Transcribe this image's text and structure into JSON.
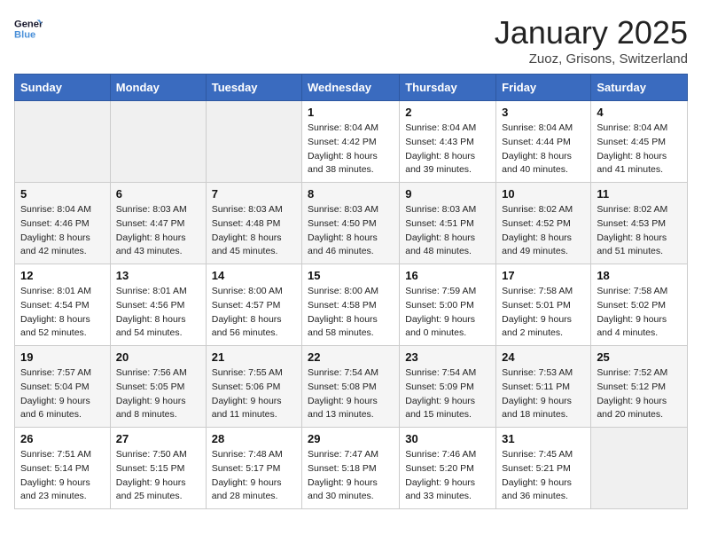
{
  "header": {
    "logo_line1": "General",
    "logo_line2": "Blue",
    "month": "January 2025",
    "location": "Zuoz, Grisons, Switzerland"
  },
  "weekdays": [
    "Sunday",
    "Monday",
    "Tuesday",
    "Wednesday",
    "Thursday",
    "Friday",
    "Saturday"
  ],
  "weeks": [
    [
      {
        "day": "",
        "info": ""
      },
      {
        "day": "",
        "info": ""
      },
      {
        "day": "",
        "info": ""
      },
      {
        "day": "1",
        "info": "Sunrise: 8:04 AM\nSunset: 4:42 PM\nDaylight: 8 hours\nand 38 minutes."
      },
      {
        "day": "2",
        "info": "Sunrise: 8:04 AM\nSunset: 4:43 PM\nDaylight: 8 hours\nand 39 minutes."
      },
      {
        "day": "3",
        "info": "Sunrise: 8:04 AM\nSunset: 4:44 PM\nDaylight: 8 hours\nand 40 minutes."
      },
      {
        "day": "4",
        "info": "Sunrise: 8:04 AM\nSunset: 4:45 PM\nDaylight: 8 hours\nand 41 minutes."
      }
    ],
    [
      {
        "day": "5",
        "info": "Sunrise: 8:04 AM\nSunset: 4:46 PM\nDaylight: 8 hours\nand 42 minutes."
      },
      {
        "day": "6",
        "info": "Sunrise: 8:03 AM\nSunset: 4:47 PM\nDaylight: 8 hours\nand 43 minutes."
      },
      {
        "day": "7",
        "info": "Sunrise: 8:03 AM\nSunset: 4:48 PM\nDaylight: 8 hours\nand 45 minutes."
      },
      {
        "day": "8",
        "info": "Sunrise: 8:03 AM\nSunset: 4:50 PM\nDaylight: 8 hours\nand 46 minutes."
      },
      {
        "day": "9",
        "info": "Sunrise: 8:03 AM\nSunset: 4:51 PM\nDaylight: 8 hours\nand 48 minutes."
      },
      {
        "day": "10",
        "info": "Sunrise: 8:02 AM\nSunset: 4:52 PM\nDaylight: 8 hours\nand 49 minutes."
      },
      {
        "day": "11",
        "info": "Sunrise: 8:02 AM\nSunset: 4:53 PM\nDaylight: 8 hours\nand 51 minutes."
      }
    ],
    [
      {
        "day": "12",
        "info": "Sunrise: 8:01 AM\nSunset: 4:54 PM\nDaylight: 8 hours\nand 52 minutes."
      },
      {
        "day": "13",
        "info": "Sunrise: 8:01 AM\nSunset: 4:56 PM\nDaylight: 8 hours\nand 54 minutes."
      },
      {
        "day": "14",
        "info": "Sunrise: 8:00 AM\nSunset: 4:57 PM\nDaylight: 8 hours\nand 56 minutes."
      },
      {
        "day": "15",
        "info": "Sunrise: 8:00 AM\nSunset: 4:58 PM\nDaylight: 8 hours\nand 58 minutes."
      },
      {
        "day": "16",
        "info": "Sunrise: 7:59 AM\nSunset: 5:00 PM\nDaylight: 9 hours\nand 0 minutes."
      },
      {
        "day": "17",
        "info": "Sunrise: 7:58 AM\nSunset: 5:01 PM\nDaylight: 9 hours\nand 2 minutes."
      },
      {
        "day": "18",
        "info": "Sunrise: 7:58 AM\nSunset: 5:02 PM\nDaylight: 9 hours\nand 4 minutes."
      }
    ],
    [
      {
        "day": "19",
        "info": "Sunrise: 7:57 AM\nSunset: 5:04 PM\nDaylight: 9 hours\nand 6 minutes."
      },
      {
        "day": "20",
        "info": "Sunrise: 7:56 AM\nSunset: 5:05 PM\nDaylight: 9 hours\nand 8 minutes."
      },
      {
        "day": "21",
        "info": "Sunrise: 7:55 AM\nSunset: 5:06 PM\nDaylight: 9 hours\nand 11 minutes."
      },
      {
        "day": "22",
        "info": "Sunrise: 7:54 AM\nSunset: 5:08 PM\nDaylight: 9 hours\nand 13 minutes."
      },
      {
        "day": "23",
        "info": "Sunrise: 7:54 AM\nSunset: 5:09 PM\nDaylight: 9 hours\nand 15 minutes."
      },
      {
        "day": "24",
        "info": "Sunrise: 7:53 AM\nSunset: 5:11 PM\nDaylight: 9 hours\nand 18 minutes."
      },
      {
        "day": "25",
        "info": "Sunrise: 7:52 AM\nSunset: 5:12 PM\nDaylight: 9 hours\nand 20 minutes."
      }
    ],
    [
      {
        "day": "26",
        "info": "Sunrise: 7:51 AM\nSunset: 5:14 PM\nDaylight: 9 hours\nand 23 minutes."
      },
      {
        "day": "27",
        "info": "Sunrise: 7:50 AM\nSunset: 5:15 PM\nDaylight: 9 hours\nand 25 minutes."
      },
      {
        "day": "28",
        "info": "Sunrise: 7:48 AM\nSunset: 5:17 PM\nDaylight: 9 hours\nand 28 minutes."
      },
      {
        "day": "29",
        "info": "Sunrise: 7:47 AM\nSunset: 5:18 PM\nDaylight: 9 hours\nand 30 minutes."
      },
      {
        "day": "30",
        "info": "Sunrise: 7:46 AM\nSunset: 5:20 PM\nDaylight: 9 hours\nand 33 minutes."
      },
      {
        "day": "31",
        "info": "Sunrise: 7:45 AM\nSunset: 5:21 PM\nDaylight: 9 hours\nand 36 minutes."
      },
      {
        "day": "",
        "info": ""
      }
    ]
  ]
}
